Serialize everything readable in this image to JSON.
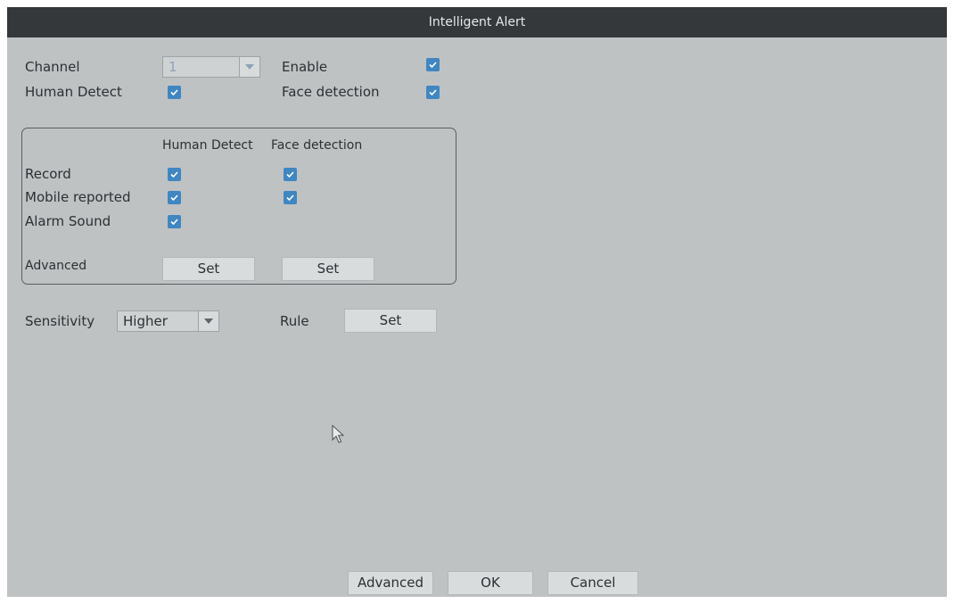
{
  "window": {
    "title": "Intelligent Alert"
  },
  "top": {
    "channel_label": "Channel",
    "channel_value": "1",
    "enable_label": "Enable",
    "human_detect_label": "Human Detect",
    "face_detection_label": "Face detection"
  },
  "group": {
    "col_human": "Human Detect",
    "col_face": "Face detection",
    "rows": [
      {
        "label": "Record"
      },
      {
        "label": "Mobile reported"
      },
      {
        "label": "Alarm Sound"
      }
    ],
    "advanced_label": "Advanced",
    "set_label": "Set"
  },
  "sensitivity": {
    "label": "Sensitivity",
    "value": "Higher"
  },
  "rule": {
    "label": "Rule",
    "set_label": "Set"
  },
  "footer": {
    "advanced": "Advanced",
    "ok": "OK",
    "cancel": "Cancel"
  },
  "colors": {
    "accent": "#3f86c2",
    "titlebar": "#34383a",
    "panel": "#bfc2c3"
  }
}
